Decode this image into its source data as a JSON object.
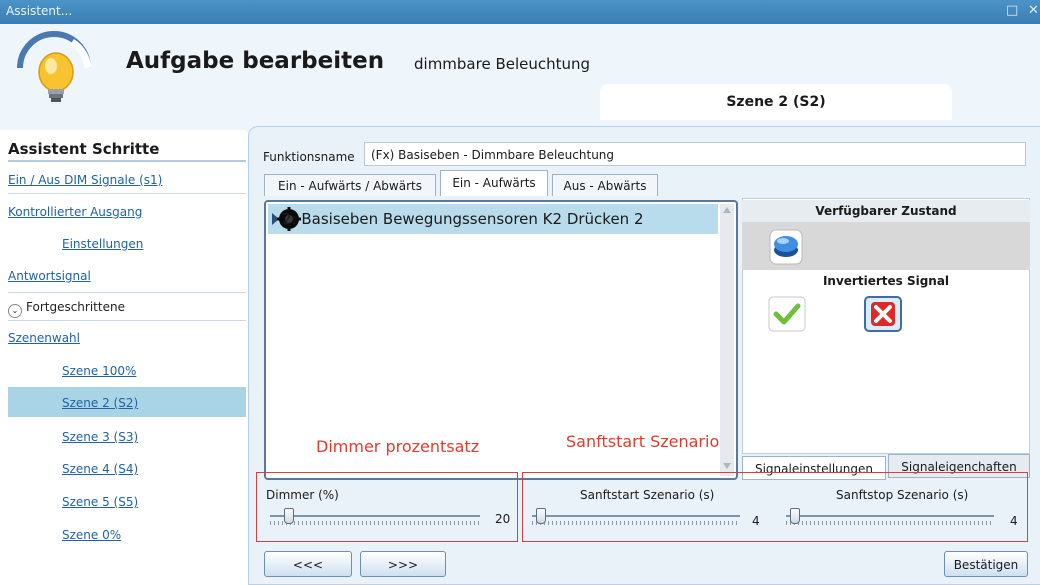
{
  "window": {
    "title": "Assistent...",
    "controls": [
      "□",
      "✕"
    ]
  },
  "header": {
    "title": "Aufgabe bearbeiten",
    "subtitle": "dimmbare Beleuchtung",
    "scene_tab": "Szene 2 (S2)"
  },
  "sidebar": {
    "title": "Assistent Schritte",
    "items": [
      {
        "label": "Ein / Aus DIM Signale (s1)"
      },
      {
        "label": "Kontrollierter Ausgang"
      },
      {
        "label": "Einstellungen"
      },
      {
        "label": "Antwortsignal"
      }
    ],
    "advanced_label": "Fortgeschrittene",
    "scene_items": [
      {
        "label": "Szenenwahl"
      },
      {
        "label": "Szene 100%"
      },
      {
        "label": "Szene 2 (S2)"
      },
      {
        "label": "Szene 3 (S3)"
      },
      {
        "label": "Szene 4 (S4)"
      },
      {
        "label": "Szene 5 (S5)"
      },
      {
        "label": "Szene 0%"
      }
    ]
  },
  "function": {
    "label": "Funktionsname",
    "value": "(Fx) Basiseben - Dimmbare Beleuchtung"
  },
  "tabs": [
    "Ein - Aufwärts / Abwärts",
    "Ein - Aufwärts",
    "Aus - Abwärts"
  ],
  "list": {
    "items": [
      "2: Basiseben Bewegungssensoren K2 Drücken 2"
    ]
  },
  "right_panel": {
    "available_state": "Verfügbarer Zustand",
    "inverted_signal": "Invertiertes Signal",
    "bottom_tabs": [
      "Signaleinstellungen",
      "Signaleigenchaften"
    ]
  },
  "annotations": {
    "dimmer": "Dimmer prozentsatz",
    "softstart": "Sanftstart Szenario"
  },
  "sliders": {
    "dimmer": {
      "label": "Dimmer (%)",
      "value": "20",
      "level": 0.07
    },
    "softstart": {
      "label": "Sanftstart Szenario (s)",
      "value": "4",
      "level": 0.02
    },
    "softstop": {
      "label": "Sanftstop Szenario (s)",
      "value": "4",
      "level": 0.02
    }
  },
  "nav": {
    "back": "<<<",
    "next": ">>>",
    "confirm": "Bestätigen"
  },
  "colors": {
    "accent": "#3b7eb3",
    "selection": "#a9d4e6",
    "annotation": "#e23b2e"
  }
}
